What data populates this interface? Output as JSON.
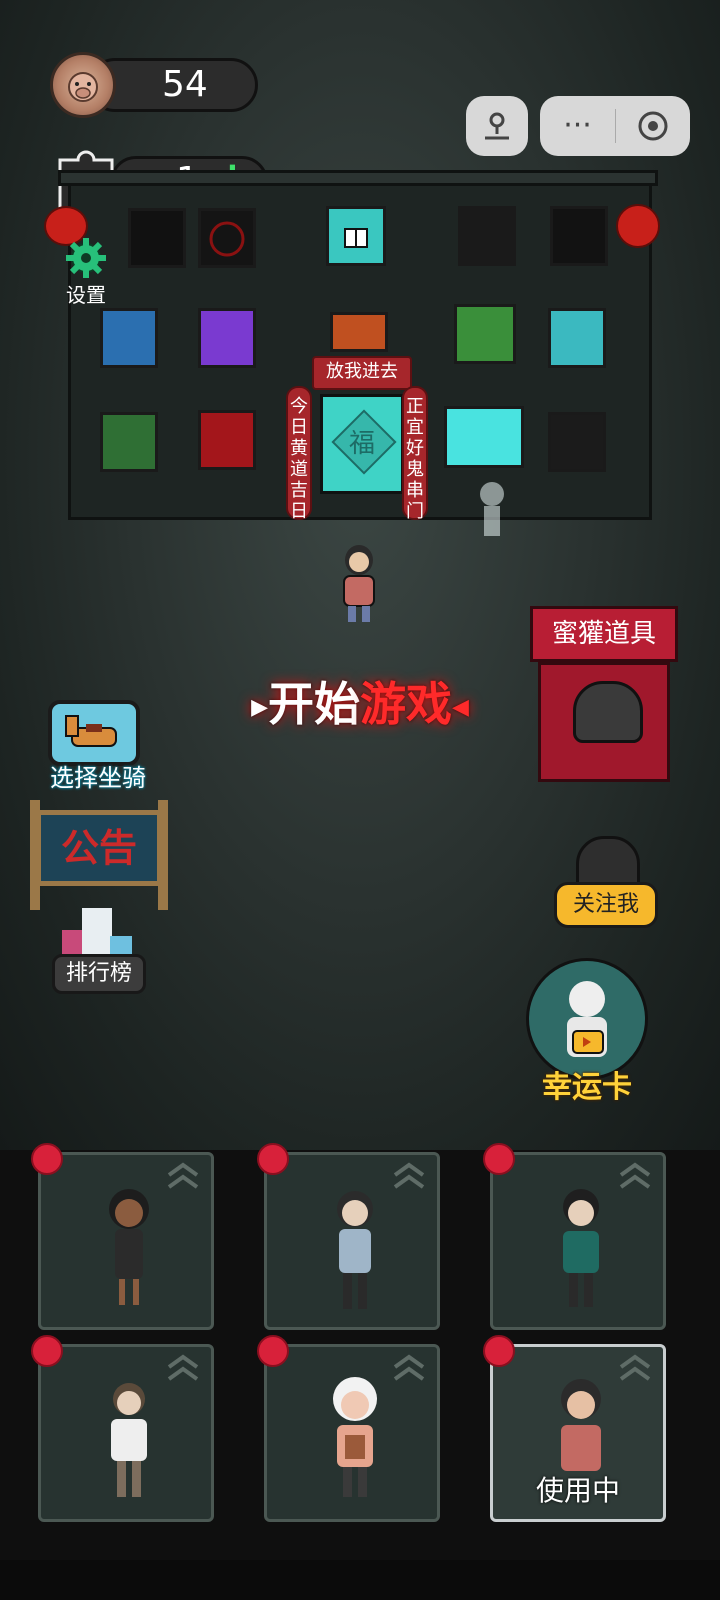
{
  "hud": {
    "coins": "54",
    "puzzle_count": "1",
    "settings_label": "设置"
  },
  "building": {
    "door_sign": "放我进去",
    "door_char": "福",
    "couplet_left": "今日黄道吉日",
    "couplet_right": "正宜好鬼串门"
  },
  "menu": {
    "start_white": "开始",
    "start_red": "游戏",
    "mount_label": "选择坐骑",
    "notice_label": "公告",
    "rank_label": "排行榜",
    "shop_label": "蜜獾道具",
    "follow_label": "关注我",
    "lucky_label": "幸运卡"
  },
  "characters": [
    {
      "name": "girl-dark-dress",
      "active": false
    },
    {
      "name": "boy-glasses-blue",
      "active": false
    },
    {
      "name": "man-beard-green",
      "active": false
    },
    {
      "name": "girl-white-shirt",
      "active": false
    },
    {
      "name": "grandma-white-hair",
      "active": false
    },
    {
      "name": "woman-glasses-pink",
      "active": true,
      "status": "使用中"
    }
  ],
  "colors": {
    "accent_red": "#d8213a",
    "gold": "#f6b82c",
    "plus_green": "#3ee06a"
  }
}
